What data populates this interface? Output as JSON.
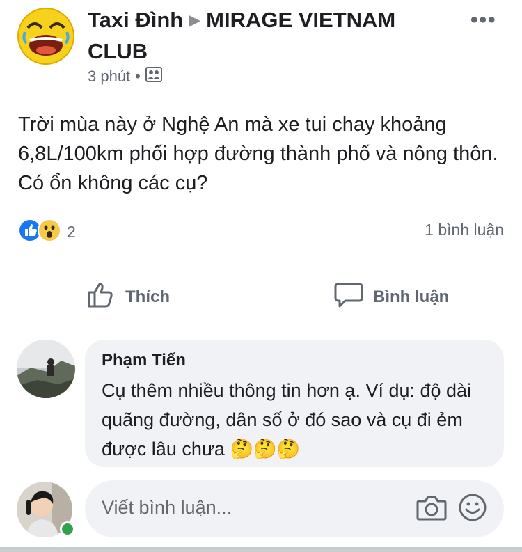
{
  "post": {
    "author": "Taxi Đình",
    "group": "MIRAGE VIETNAM CLUB",
    "time": "3 phút",
    "text": "Trời mùa này ở Nghệ An mà xe tui chay khoảng 6,8L/100km phối hợp đường thành phố và nông thôn. Có ổn không các cụ?",
    "reaction_count": "2",
    "comment_count": "1 bình luận"
  },
  "actions": {
    "like_label": "Thích",
    "comment_label": "Bình luận"
  },
  "comment": {
    "author": "Phạm Tiến",
    "text": "Cụ thêm nhiều thông tin hơn ạ. Ví dụ: độ dài quãng đường, dân số ở đó sao và cụ đi ẻm được lâu chưa",
    "emojis": "🤔🤔🤔"
  },
  "composer": {
    "placeholder": "Viết bình luận..."
  },
  "icons": {
    "more": "more-options-icon",
    "privacy": "group-privacy-icon",
    "like_reaction": "like-reaction-icon",
    "wow_reaction": "wow-reaction-icon",
    "like": "thumbs-up-icon",
    "comment": "comment-bubble-icon",
    "camera": "camera-icon",
    "emoji": "emoji-icon"
  },
  "colors": {
    "text": "#1c1e21",
    "secondary": "#606770",
    "bubble": "#f0f2f5",
    "like_blue": "#1877f2",
    "online": "#31a24c"
  }
}
